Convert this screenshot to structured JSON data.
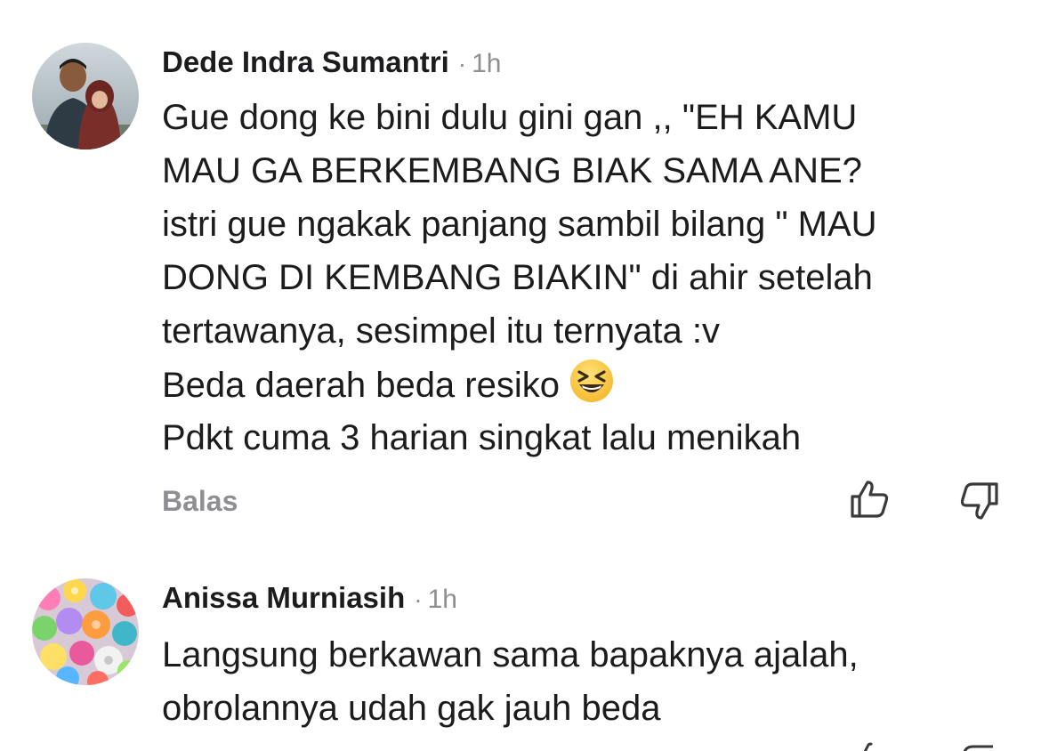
{
  "comments": [
    {
      "author": "Dede Indra Sumantri",
      "separator": "·",
      "time": "1h",
      "avatar_icon": "profile-photo-man-with-child",
      "lines": [
        "Gue dong ke bini dulu gini gan  ,, \"EH KAMU",
        "MAU GA BERKEMBANG BIAK SAMA ANE?",
        "istri gue ngakak panjang sambil bilang \" MAU",
        "DONG DI KEMBANG BIAKIN\"  di ahir setelah",
        "tertawanya, sesimpel itu ternyata :v",
        "Beda daerah beda resiko",
        "Pdkt cuma 3 harian singkat lalu menikah"
      ],
      "emoji_icon": "grinning-squinting-face-emoji",
      "reply_label": "Balas",
      "upvote_icon": "thumbs-up-icon",
      "downvote_icon": "thumbs-down-icon"
    },
    {
      "author": "Anissa Murniasih",
      "separator": "·",
      "time": "1h",
      "avatar_icon": "profile-photo-colorful-buttons",
      "lines": [
        "Langsung berkawan sama bapaknya ajalah,",
        "obrolannya udah gak jauh beda"
      ]
    }
  ],
  "colors": {
    "text": "#1c1c1e",
    "muted": "#8e8e93",
    "background": "#ffffff"
  }
}
